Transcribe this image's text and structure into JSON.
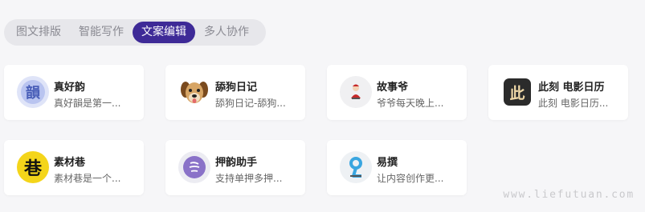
{
  "tabs": [
    {
      "label": "图文排版",
      "active": false
    },
    {
      "label": "智能写作",
      "active": false
    },
    {
      "label": "文案编辑",
      "active": true
    },
    {
      "label": "多人协作",
      "active": false
    }
  ],
  "cards": [
    {
      "name": "真好韵",
      "desc": "真好韻是第一...",
      "icon": "zhenhaoyun-logo-icon",
      "icon_text": "韻"
    },
    {
      "name": "舔狗日记",
      "desc": "舔狗日记-舔狗...",
      "icon": "dog-face-icon"
    },
    {
      "name": "故事爷",
      "desc": "爷爷每天晚上...",
      "icon": "grandpa-figure-icon"
    },
    {
      "name": "此刻 电影日历",
      "desc": "此刻 电影日历...",
      "icon": "cike-logo-icon",
      "icon_text": "此"
    },
    {
      "name": "素材巷",
      "desc": "素材巷是一个...",
      "icon": "sucaixiang-logo-icon",
      "icon_text": "巷"
    },
    {
      "name": "押韵助手",
      "desc": "支持单押多押...",
      "icon": "rhyme-assistant-logo-icon"
    },
    {
      "name": "易撰",
      "desc": "让内容创作更...",
      "icon": "yizhuan-logo-icon"
    }
  ],
  "watermark": "www.liefutuan.com",
  "colors": {
    "accent": "#3e2a97",
    "background": "#f6f6f8"
  }
}
